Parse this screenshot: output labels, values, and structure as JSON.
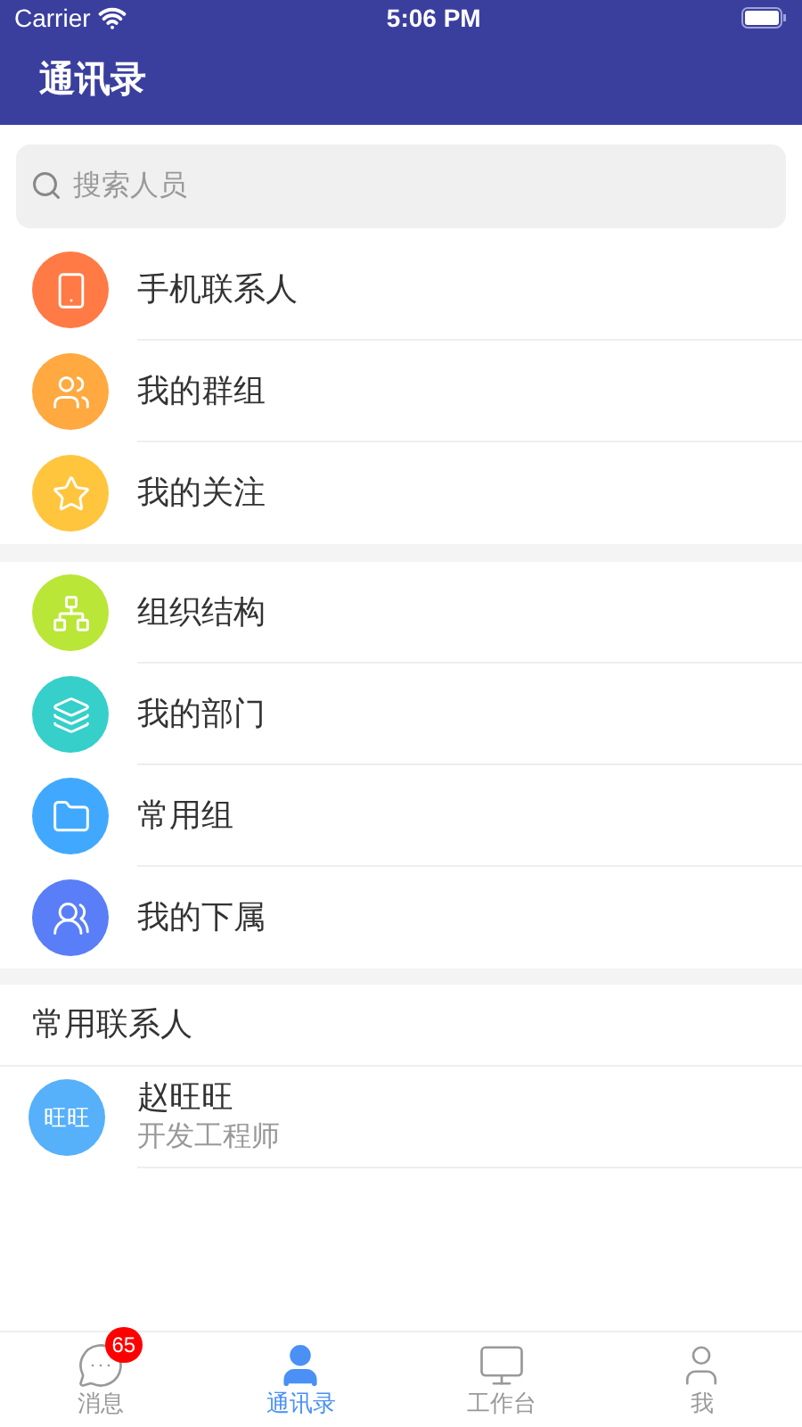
{
  "status_bar": {
    "carrier": "Carrier",
    "time": "5:06 PM"
  },
  "header": {
    "title": "通讯录"
  },
  "search": {
    "placeholder": "搜索人员"
  },
  "groups": [
    {
      "items": [
        {
          "label": "手机联系人",
          "kind": "phone",
          "color": "#ff7a45"
        },
        {
          "label": "我的群组",
          "kind": "group",
          "color": "#ffa940"
        },
        {
          "label": "我的关注",
          "kind": "star",
          "color": "#ffc53d"
        }
      ]
    },
    {
      "items": [
        {
          "label": "组织结构",
          "kind": "org",
          "color": "#bae637"
        },
        {
          "label": "我的部门",
          "kind": "layers",
          "color": "#36cfc9"
        },
        {
          "label": "常用组",
          "kind": "folder",
          "color": "#40a9ff"
        },
        {
          "label": "我的下属",
          "kind": "subordinate",
          "color": "#597ef7"
        }
      ]
    }
  ],
  "frequent": {
    "title": "常用联系人",
    "contacts": [
      {
        "avatar": "旺旺",
        "name": "赵旺旺",
        "role": "开发工程师"
      }
    ]
  },
  "tabs": [
    {
      "label": "消息",
      "kind": "chat",
      "selected": false,
      "badge": "65"
    },
    {
      "label": "通讯录",
      "kind": "contacts",
      "selected": true
    },
    {
      "label": "工作台",
      "kind": "monitor",
      "selected": false
    },
    {
      "label": "我",
      "kind": "user",
      "selected": false
    }
  ]
}
